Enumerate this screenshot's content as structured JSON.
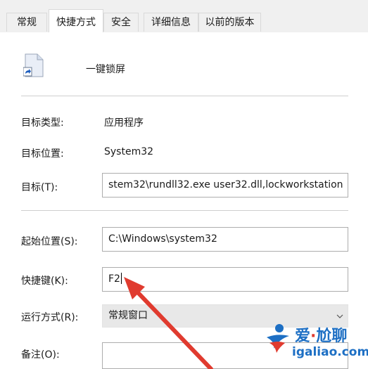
{
  "tabs": [
    {
      "label": "常规",
      "active": false
    },
    {
      "label": "快捷方式",
      "active": true
    },
    {
      "label": "安全",
      "active": false
    },
    {
      "label": "详细信息",
      "active": false
    },
    {
      "label": "以前的版本",
      "active": false
    }
  ],
  "shortcut": {
    "name": "一键锁屏",
    "icon": "shortcut-file-icon"
  },
  "fields": {
    "target_type": {
      "label": "目标类型:",
      "value": "应用程序"
    },
    "target_location": {
      "label": "目标位置:",
      "value": "System32"
    },
    "target": {
      "label": "目标(T):",
      "value": "stem32\\rundll32.exe user32.dll,lockworkstation"
    },
    "start_in": {
      "label": "起始位置(S):",
      "value": "C:\\Windows\\system32"
    },
    "shortcut_key": {
      "label": "快捷键(K):",
      "value": "F2"
    },
    "run": {
      "label": "运行方式(R):",
      "value": "常规窗口"
    },
    "comment": {
      "label": "备注(O):",
      "value": ""
    }
  },
  "annotation": {
    "type": "red-arrow",
    "color": "#e03b2f"
  },
  "watermark": {
    "brand_left": "爱",
    "dot": "·",
    "brand_right": "尬聊",
    "url": "igaliao.com"
  }
}
